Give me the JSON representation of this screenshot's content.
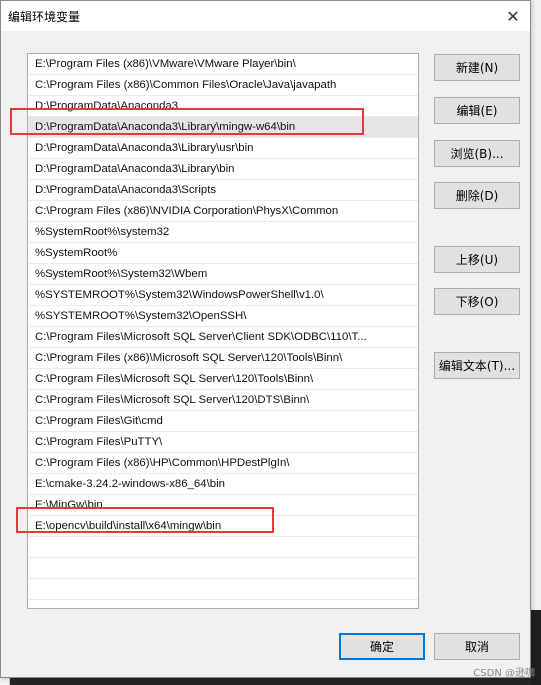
{
  "dialog": {
    "title": "编辑环境变量",
    "close_glyph": "✕"
  },
  "path_entries": [
    "E:\\Program Files (x86)\\VMware\\VMware Player\\bin\\",
    "C:\\Program Files (x86)\\Common Files\\Oracle\\Java\\javapath",
    "D:\\ProgramData\\Anaconda3",
    "D:\\ProgramData\\Anaconda3\\Library\\mingw-w64\\bin",
    "D:\\ProgramData\\Anaconda3\\Library\\usr\\bin",
    "D:\\ProgramData\\Anaconda3\\Library\\bin",
    "D:\\ProgramData\\Anaconda3\\Scripts",
    "C:\\Program Files (x86)\\NVIDIA Corporation\\PhysX\\Common",
    "%SystemRoot%\\system32",
    "%SystemRoot%",
    "%SystemRoot%\\System32\\Wbem",
    "%SYSTEMROOT%\\System32\\WindowsPowerShell\\v1.0\\",
    "%SYSTEMROOT%\\System32\\OpenSSH\\",
    "C:\\Program Files\\Microsoft SQL Server\\Client SDK\\ODBC\\110\\T...",
    "C:\\Program Files (x86)\\Microsoft SQL Server\\120\\Tools\\Binn\\",
    "C:\\Program Files\\Microsoft SQL Server\\120\\Tools\\Binn\\",
    "C:\\Program Files\\Microsoft SQL Server\\120\\DTS\\Binn\\",
    "C:\\Program Files\\Git\\cmd",
    "C:\\Program Files\\PuTTY\\",
    "C:\\Program Files (x86)\\HP\\Common\\HPDestPlgIn\\",
    "E:\\cmake-3.24.2-windows-x86_64\\bin",
    "E:\\MinGw\\bin",
    "E:\\opencv\\build\\install\\x64\\mingw\\bin"
  ],
  "selected_index": 3,
  "highlighted_indices": [
    3,
    22
  ],
  "highlight_color": "#e03a3a",
  "buttons": {
    "new": "新建(N)",
    "edit": "编辑(E)",
    "browse": "浏览(B)...",
    "delete": "删除(D)",
    "move_up": "上移(U)",
    "move_down": "下移(O)",
    "edit_text": "编辑文本(T)...",
    "ok": "确定",
    "cancel": "取消"
  },
  "watermark": "CSDN @逊咖‍"
}
